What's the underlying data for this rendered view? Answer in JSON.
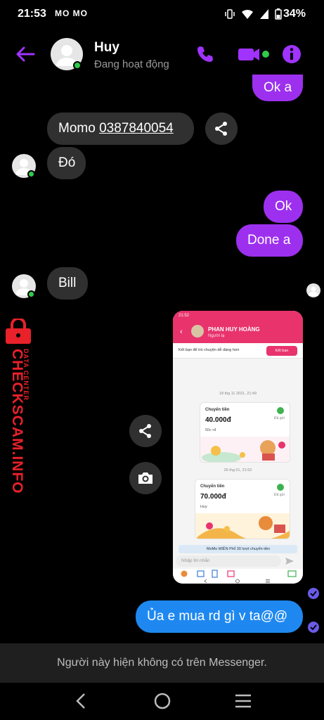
{
  "statusbar": {
    "time": "21:53",
    "notif_apps": "MO MO",
    "battery": "34%"
  },
  "header": {
    "name": "Huy",
    "status": "Đang hoạt động"
  },
  "messages": {
    "m1": "Ok a",
    "m2_prefix": "Momo ",
    "m2_phone": "0387840054",
    "m3": "Đó",
    "m4": "Ok",
    "m5": "Done a",
    "m6": "Bill",
    "m7": "Ủa e mua rd gì v ta@@"
  },
  "watermark": {
    "brand": "CHECKSCAM.INFO",
    "tagline": "DATA CENTER"
  },
  "screenshot": {
    "status": "21:52",
    "name": "PHAN HUY HOÀNG",
    "sub": "Người lạ",
    "banner": "Kết bạn để trò chuyện dễ dàng hơn",
    "add_btn": "Kết bạn",
    "date1": "18 thg 11 2021, 21:49",
    "card1": {
      "title": "Chuyển tiền",
      "amount": "40.000đ",
      "note": "50c rđ",
      "state": "Đã gửi"
    },
    "date2": "26 thg 01, 21:52",
    "card2": {
      "title": "Chuyển tiền",
      "amount": "70.000đ",
      "note": "Huy",
      "state": "Đã gửi"
    },
    "promo": "MoMo MIỄN PHÍ 30 lượt chuyển tiền",
    "input_placeholder": "Nhập tin nhắn"
  },
  "footer": {
    "text": "Người này hiện không có trên Messenger."
  },
  "colors": {
    "outgoing": "#9d30ee",
    "outgoing_latest": "#1e88f0",
    "incoming": "#303030",
    "accent": "#a033ff",
    "momo_pink": "#e8336d"
  }
}
